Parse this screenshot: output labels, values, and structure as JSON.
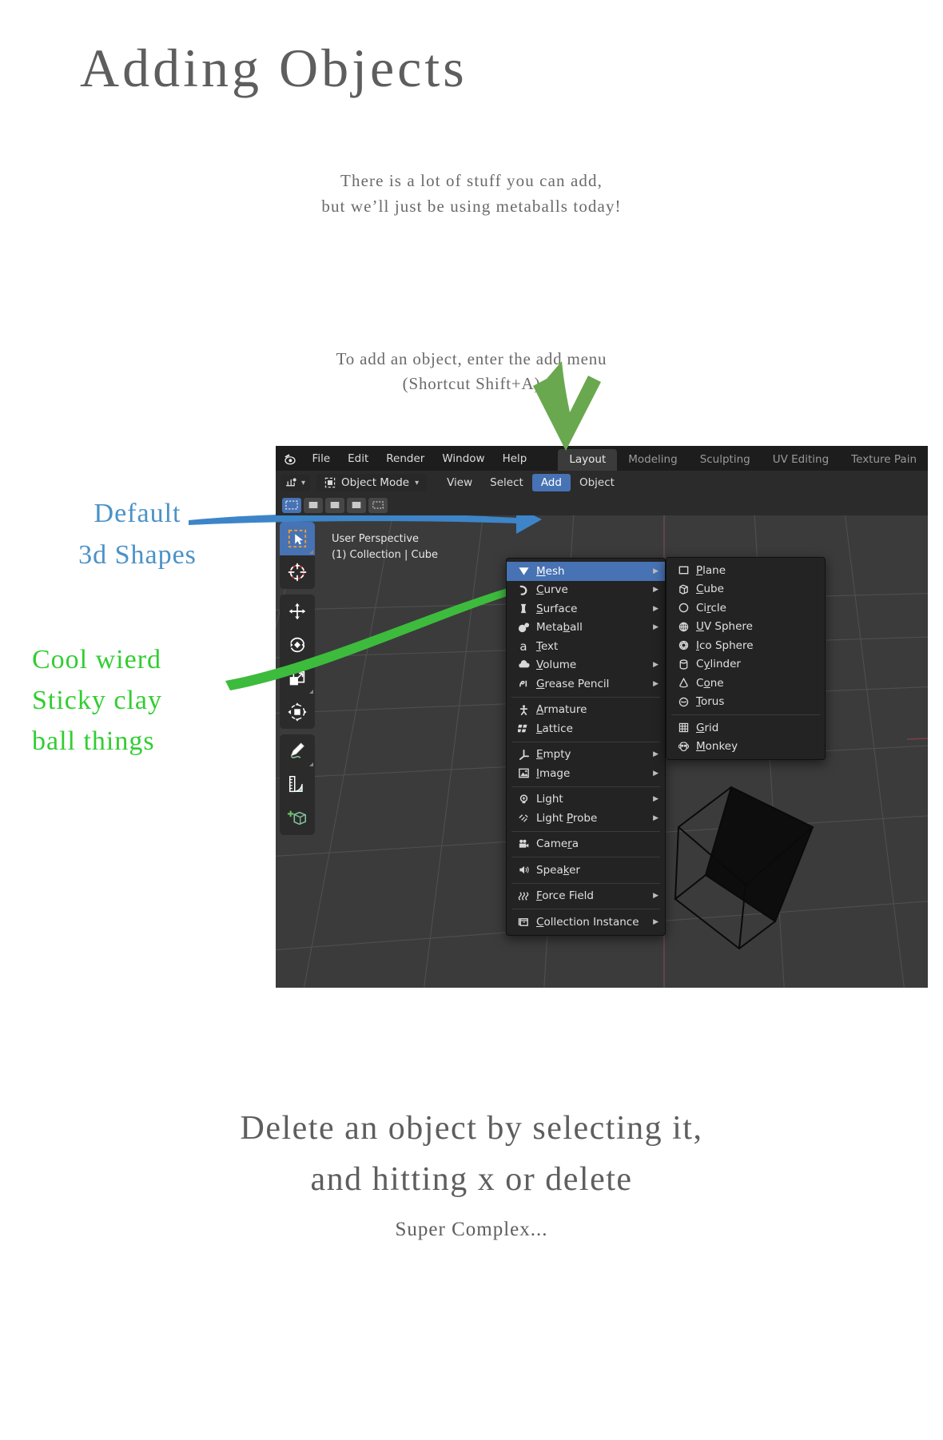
{
  "slide": {
    "title": "Adding Objects",
    "subtitle_line1": "There is a lot of stuff you can add,",
    "subtitle_line2": "but we’ll just be using metaballs today!",
    "instruction_line1": "To add an object, enter the add menu",
    "instruction_line2": "(Shortcut Shift+A)",
    "footer_line1": "Delete an object by selecting it,",
    "footer_line2": "and hitting x or delete",
    "footer_note": "Super Complex...",
    "title_color": "#5e5e5e",
    "body_color": "#6a6a6a"
  },
  "annotations": {
    "blue": {
      "line1": "Default",
      "line2": "3d Shapes",
      "color": "#4a92c8"
    },
    "green": {
      "line1": "Cool wierd",
      "line2": "Sticky clay",
      "line3": "ball things",
      "color": "#32cd32"
    },
    "arrow_down_color": "#6aa84f",
    "arrow_blue_color": "#3d85c8"
  },
  "blender": {
    "logo_icon": "blender-logo-icon",
    "top_menus": [
      "File",
      "Edit",
      "Render",
      "Window",
      "Help"
    ],
    "workspace_tabs": [
      {
        "label": "Layout",
        "active": true
      },
      {
        "label": "Modeling",
        "active": false
      },
      {
        "label": "Sculpting",
        "active": false
      },
      {
        "label": "UV Editing",
        "active": false
      },
      {
        "label": "Texture Pain",
        "active": false
      }
    ],
    "editor_type_icon": "editor-type-icon",
    "mode_icon": "object-mode-icon",
    "mode_label": "Object Mode",
    "mode_chevron": "chevron-down-icon",
    "header_menus": [
      {
        "label": "View",
        "active": false
      },
      {
        "label": "Select",
        "active": false
      },
      {
        "label": "Add",
        "active": true
      },
      {
        "label": "Object",
        "active": false
      }
    ],
    "active_menu_color": "#4772b3",
    "viewport": {
      "perspective_label": "User Perspective",
      "collection_label": "(1) Collection | Cube",
      "background_color": "#3b3b3b",
      "grid_color": "#505050"
    },
    "toolbar": [
      {
        "name": "tweak-select-box-tool",
        "active": true
      },
      {
        "name": "cursor-tool",
        "active": false
      },
      {
        "name": "move-tool",
        "active": false
      },
      {
        "name": "rotate-tool",
        "active": false
      },
      {
        "name": "scale-tool",
        "active": false
      },
      {
        "name": "transform-tool",
        "active": false
      },
      {
        "name": "annotate-tool",
        "active": false
      },
      {
        "name": "measure-tool",
        "active": false
      },
      {
        "name": "add-cube-tool",
        "active": false
      }
    ],
    "select_mode_buttons": [
      "select-set",
      "select-extend",
      "select-subtract",
      "select-invert",
      "select-intersect"
    ],
    "add_menu": {
      "title": "Add",
      "items": [
        {
          "label": "Mesh",
          "accel": "M",
          "icon": "mesh-icon",
          "submenu": true,
          "selected": true,
          "sep_after": false
        },
        {
          "label": "Curve",
          "accel": "C",
          "icon": "curve-icon",
          "submenu": true,
          "selected": false,
          "sep_after": false
        },
        {
          "label": "Surface",
          "accel": "S",
          "icon": "surface-icon",
          "submenu": true,
          "selected": false,
          "sep_after": false
        },
        {
          "label": "Metaball",
          "accel": "b",
          "icon": "metaball-icon",
          "submenu": true,
          "selected": false,
          "sep_after": false
        },
        {
          "label": "Text",
          "accel": "T",
          "icon": "text-icon",
          "submenu": false,
          "selected": false,
          "sep_after": false
        },
        {
          "label": "Volume",
          "accel": "V",
          "icon": "volume-icon",
          "submenu": true,
          "selected": false,
          "sep_after": false
        },
        {
          "label": "Grease Pencil",
          "accel": "G",
          "icon": "grease-pencil-icon",
          "submenu": true,
          "selected": false,
          "sep_after": true
        },
        {
          "label": "Armature",
          "accel": "A",
          "icon": "armature-icon",
          "submenu": false,
          "selected": false,
          "sep_after": false
        },
        {
          "label": "Lattice",
          "accel": "L",
          "icon": "lattice-icon",
          "submenu": false,
          "selected": false,
          "sep_after": true
        },
        {
          "label": "Empty",
          "accel": "E",
          "icon": "empty-icon",
          "submenu": true,
          "selected": false,
          "sep_after": false
        },
        {
          "label": "Image",
          "accel": "I",
          "icon": "image-icon",
          "submenu": true,
          "selected": false,
          "sep_after": true
        },
        {
          "label": "Light",
          "accel": "g",
          "icon": "light-icon",
          "submenu": true,
          "selected": false,
          "sep_after": false
        },
        {
          "label": "Light Probe",
          "accel": "P",
          "icon": "light-probe-icon",
          "submenu": true,
          "selected": false,
          "sep_after": true
        },
        {
          "label": "Camera",
          "accel": "r",
          "icon": "camera-icon",
          "submenu": false,
          "selected": false,
          "sep_after": true
        },
        {
          "label": "Speaker",
          "accel": "k",
          "icon": "speaker-icon",
          "submenu": false,
          "selected": false,
          "sep_after": true
        },
        {
          "label": "Force Field",
          "accel": "F",
          "icon": "force-field-icon",
          "submenu": true,
          "selected": false,
          "sep_after": true
        },
        {
          "label": "Collection Instance",
          "accel": "C",
          "icon": "collection-instance-icon",
          "submenu": true,
          "selected": false,
          "sep_after": false
        }
      ]
    },
    "mesh_submenu": {
      "items": [
        {
          "label": "Plane",
          "accel": "P",
          "icon": "plane-icon",
          "sep_after": false
        },
        {
          "label": "Cube",
          "accel": "C",
          "icon": "cube-icon",
          "sep_after": false
        },
        {
          "label": "Circle",
          "accel": "r",
          "icon": "circle-icon",
          "sep_after": false
        },
        {
          "label": "UV Sphere",
          "accel": "U",
          "icon": "uv-sphere-icon",
          "sep_after": false
        },
        {
          "label": "Ico Sphere",
          "accel": "I",
          "icon": "ico-sphere-icon",
          "sep_after": false
        },
        {
          "label": "Cylinder",
          "accel": "y",
          "icon": "cylinder-icon",
          "sep_after": false
        },
        {
          "label": "Cone",
          "accel": "o",
          "icon": "cone-icon",
          "sep_after": false
        },
        {
          "label": "Torus",
          "accel": "T",
          "icon": "torus-icon",
          "sep_after": true
        },
        {
          "label": "Grid",
          "accel": "G",
          "icon": "grid-icon",
          "sep_after": false
        },
        {
          "label": "Monkey",
          "accel": "M",
          "icon": "monkey-icon",
          "sep_after": false
        }
      ]
    }
  }
}
